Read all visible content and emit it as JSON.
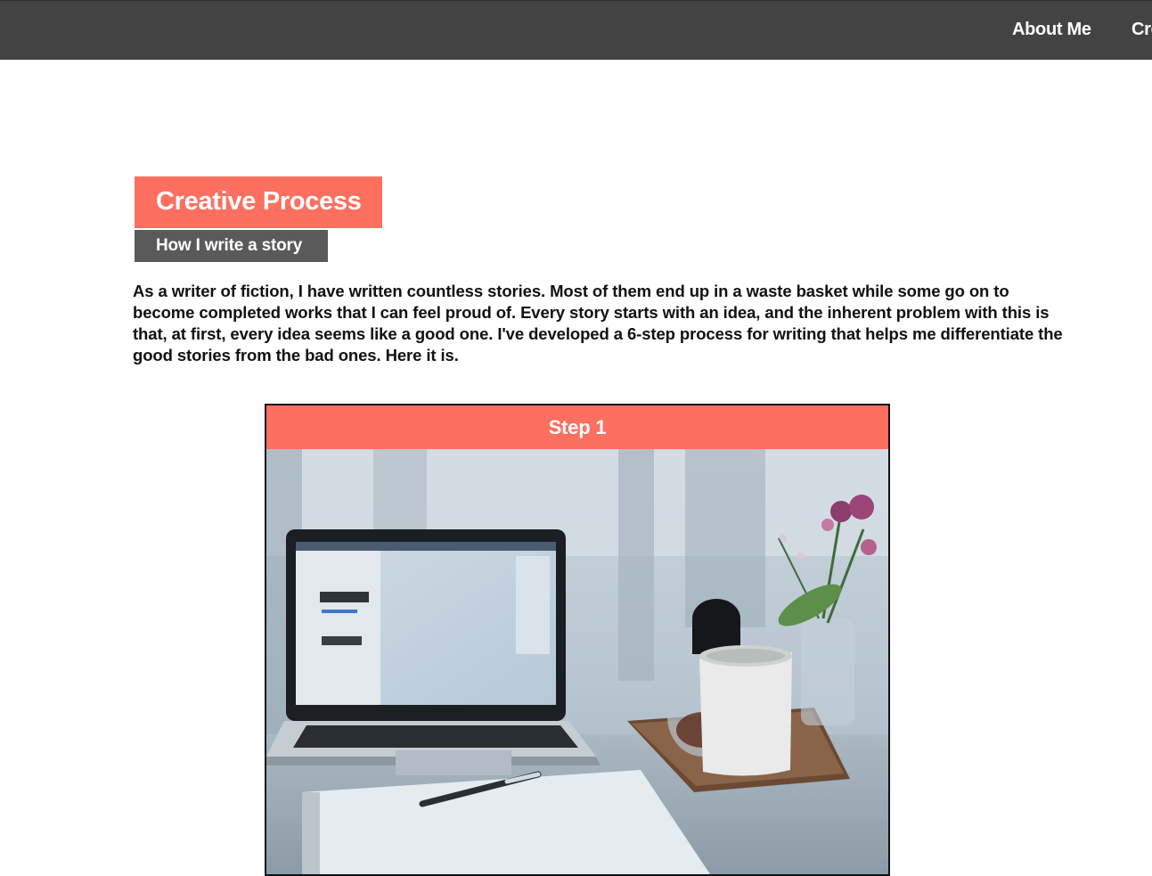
{
  "nav": {
    "items": [
      {
        "label": "About Me"
      },
      {
        "label": "Cre"
      }
    ]
  },
  "header": {
    "title": "Creative Process",
    "subtitle": "How I write a story"
  },
  "intro": {
    "text": "As a writer of fiction, I have written countless stories. Most of them end up in a waste basket while some go on to become completed works that I can feel proud of. Every story starts with an idea, and the inherent problem with this is that, at first, every idea seems like a good one. I've developed a 6-step process for writing that helps me differentiate the good stories from the bad ones. Here it is."
  },
  "steps": [
    {
      "label": "Step 1"
    }
  ],
  "colors": {
    "topbar": "#434343",
    "accent": "#fd6f5f",
    "subtitle_bg": "#5a5a5a",
    "text": "#111111"
  }
}
